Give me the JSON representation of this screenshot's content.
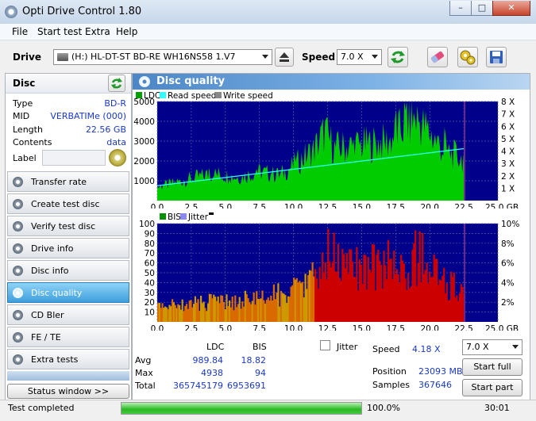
{
  "window": {
    "title": "Opti Drive Control 1.80",
    "min": "–",
    "max": "□",
    "close": "✕"
  },
  "menu": [
    "File",
    "Start test",
    "Extra",
    "Help"
  ],
  "toolbar": {
    "drive_label": "Drive",
    "drive_value": "(H:)   HL-DT-ST BD-RE  WH16NS58 1.V7",
    "speed_label": "Speed",
    "speed_value": "7.0 X"
  },
  "disc": {
    "header": "Disc",
    "fields": [
      {
        "key": "Type",
        "value": "BD-R"
      },
      {
        "key": "MID",
        "value": "VERBATIMe (000)"
      },
      {
        "key": "Length",
        "value": "22.56 GB"
      },
      {
        "key": "Contents",
        "value": "data"
      }
    ],
    "label_key": "Label",
    "label_value": ""
  },
  "nav": [
    "Transfer rate",
    "Create test disc",
    "Verify test disc",
    "Drive info",
    "Disc info",
    "Disc quality",
    "CD Bler",
    "FE / TE",
    "Extra tests"
  ],
  "nav_active": 5,
  "status_window_button": "Status window >>",
  "panel_title": "Disc quality",
  "chart_data": [
    {
      "type": "area",
      "legend": [
        "LDC",
        "Read speed",
        "Write speed"
      ],
      "colors": {
        "LDC": "#00cc00",
        "Read speed": "#33ffff",
        "Write speed": "#888888",
        "background": "#00008b"
      },
      "xlim": [
        0,
        25
      ],
      "ylim": [
        0,
        5000
      ],
      "y2lim": [
        0,
        8
      ],
      "x_ticks": [
        "0.0",
        "2.5",
        "5.0",
        "7.5",
        "10.0",
        "12.5",
        "15.0",
        "17.5",
        "20.0",
        "22.5",
        "25.0 GB"
      ],
      "y_ticks": [
        "1000",
        "2000",
        "3000",
        "4000",
        "5000"
      ],
      "y2_ticks": [
        "1 X",
        "2 X",
        "3 X",
        "4 X",
        "5 X",
        "6 X",
        "7 X",
        "8 X"
      ],
      "data_end": 22.56,
      "ldc_profile": [
        [
          0,
          800
        ],
        [
          2,
          1200
        ],
        [
          4,
          1600
        ],
        [
          6,
          1400
        ],
        [
          7.5,
          1700
        ],
        [
          9,
          1500
        ],
        [
          10.5,
          2400
        ],
        [
          11.5,
          3000
        ],
        [
          12.3,
          4100
        ],
        [
          13,
          3100
        ],
        [
          14,
          3200
        ],
        [
          15,
          3300
        ],
        [
          16,
          3400
        ],
        [
          17,
          3500
        ],
        [
          18,
          4300
        ],
        [
          19,
          4900
        ],
        [
          20,
          4000
        ],
        [
          21,
          3000
        ],
        [
          22.56,
          2400
        ]
      ],
      "read_speed": [
        [
          0,
          1.2
        ],
        [
          22.56,
          4.2
        ]
      ]
    },
    {
      "type": "area",
      "legend": [
        "BIS",
        "Jitter"
      ],
      "colors": {
        "BIS": "#cc0000",
        "BIS_low": "#cc9900",
        "Jitter": "#8888ff",
        "background": "#00008b"
      },
      "xlim": [
        0,
        25
      ],
      "ylim": [
        0,
        100
      ],
      "y2lim": [
        0,
        10
      ],
      "x_ticks": [
        "0.0",
        "2.5",
        "5.0",
        "7.5",
        "10.0",
        "12.5",
        "15.0",
        "17.5",
        "20.0",
        "22.5",
        "25.0 GB"
      ],
      "y_ticks": [
        "10",
        "20",
        "30",
        "40",
        "50",
        "60",
        "70",
        "80",
        "90",
        "100"
      ],
      "y2_ticks": [
        "2%",
        "4%",
        "6%",
        "8%",
        "10%"
      ],
      "data_end": 22.56,
      "bis_profile": [
        [
          0,
          18
        ],
        [
          2,
          22
        ],
        [
          4,
          24
        ],
        [
          6,
          26
        ],
        [
          8,
          30
        ],
        [
          10,
          38
        ],
        [
          11,
          48
        ],
        [
          12,
          60
        ],
        [
          12.5,
          85
        ],
        [
          13.5,
          70
        ],
        [
          15,
          62
        ],
        [
          16,
          70
        ],
        [
          17,
          72
        ],
        [
          18,
          60
        ],
        [
          19,
          80
        ],
        [
          20,
          70
        ],
        [
          21,
          48
        ],
        [
          22.56,
          35
        ]
      ]
    }
  ],
  "stats": {
    "col_ldc": "LDC",
    "col_bis": "BIS",
    "rows": [
      {
        "label": "Avg",
        "ldc": "989.84",
        "bis": "18.82"
      },
      {
        "label": "Max",
        "ldc": "4938",
        "bis": "94"
      },
      {
        "label": "Total",
        "ldc": "365745179",
        "bis": "6953691"
      }
    ],
    "jitter_label": "Jitter",
    "speed_label": "Speed",
    "speed_value": "4.18 X",
    "position_label": "Position",
    "position_value": "23093 MB",
    "samples_label": "Samples",
    "samples_value": "367646",
    "speed_select": "7.0 X",
    "start_full": "Start full",
    "start_part": "Start part"
  },
  "status": {
    "text": "Test completed",
    "progress_percent": 100,
    "progress_label": "100.0%",
    "time": "30:01"
  }
}
